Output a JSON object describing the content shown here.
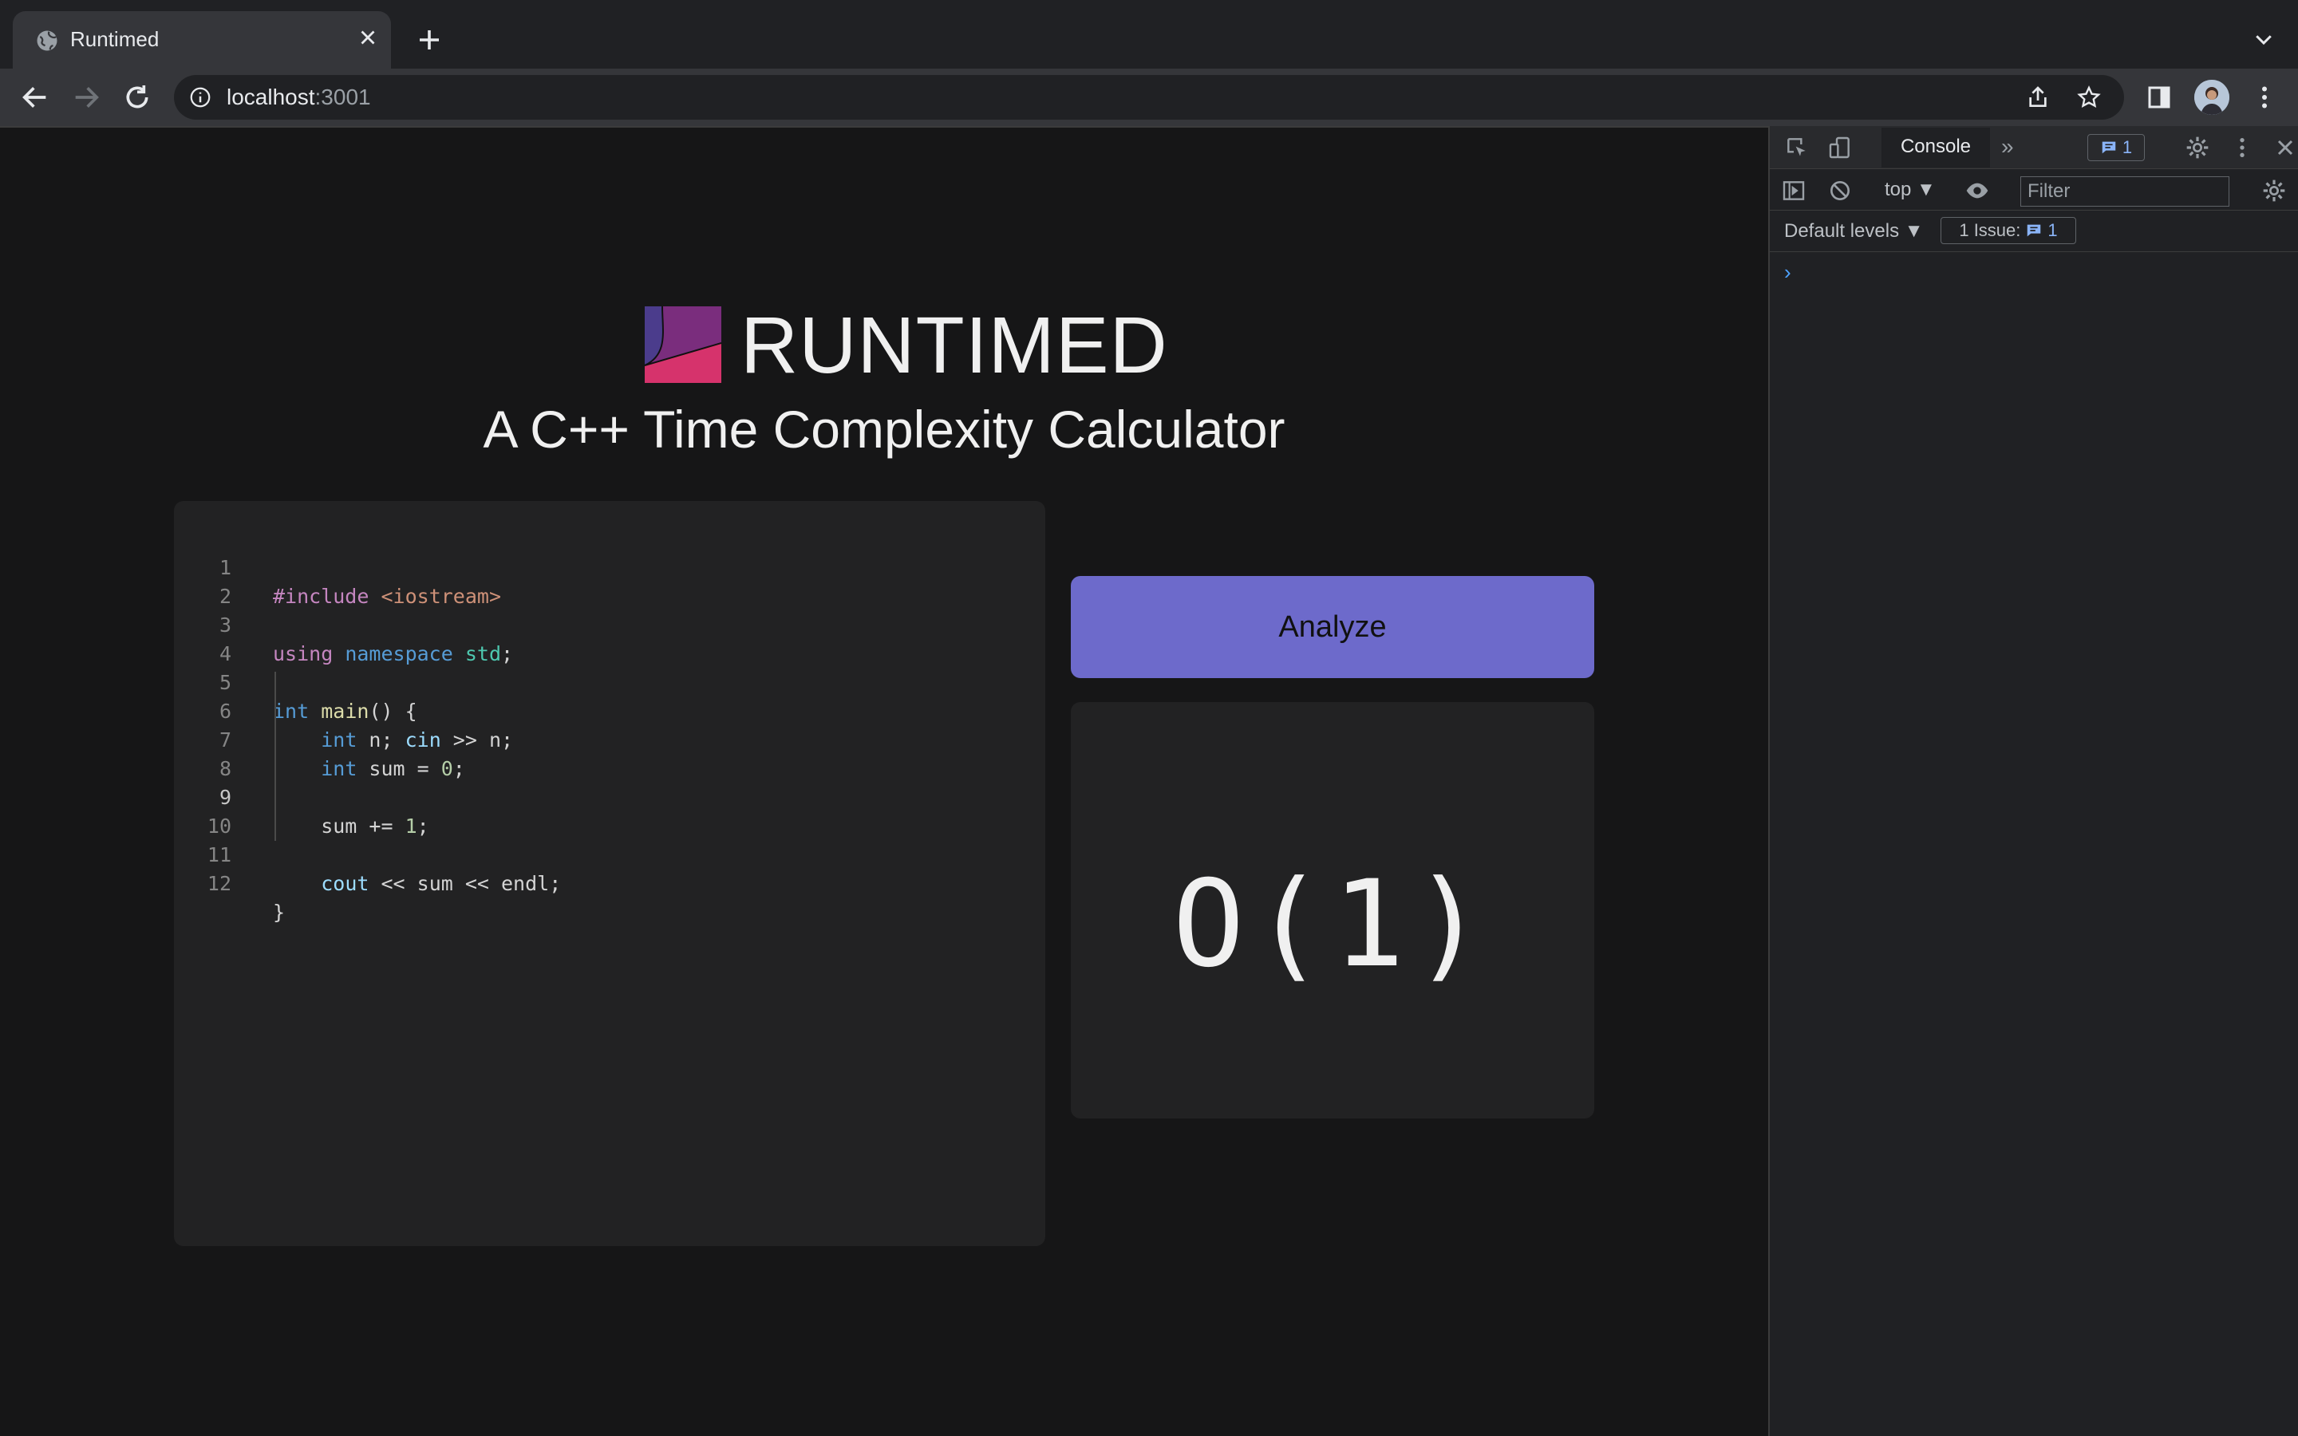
{
  "browser": {
    "tab_title": "Runtimed",
    "url_host": "localhost",
    "url_port": ":3001"
  },
  "page": {
    "brand_name": "RUNTIMED",
    "subtitle": "A C++ Time Complexity Calculator",
    "logo_colors": [
      "#4b3c8c",
      "#7a2d7d",
      "#d6336c"
    ],
    "analyze_label": "Analyze",
    "result": "O(1)",
    "accent_color": "#6d6acb"
  },
  "editor": {
    "active_line": 9,
    "lines": [
      {
        "n": "1",
        "text": "#include <iostream>"
      },
      {
        "n": "2",
        "text": ""
      },
      {
        "n": "3",
        "text": "using namespace std;"
      },
      {
        "n": "4",
        "text": ""
      },
      {
        "n": "5",
        "text": "int main() {"
      },
      {
        "n": "6",
        "text": "    int n; cin >> n;"
      },
      {
        "n": "7",
        "text": "    int sum = 0;"
      },
      {
        "n": "8",
        "text": ""
      },
      {
        "n": "9",
        "text": "    sum += 1;"
      },
      {
        "n": "10",
        "text": ""
      },
      {
        "n": "11",
        "text": "    cout << sum << endl;"
      },
      {
        "n": "12",
        "text": "}"
      }
    ]
  },
  "devtools": {
    "console_tab": "Console",
    "issue_badge_count": "1",
    "context": "top",
    "filter_placeholder": "Filter",
    "levels": "Default levels",
    "issues_label": "1 Issue:",
    "issues_count": "1",
    "prompt": "›"
  }
}
